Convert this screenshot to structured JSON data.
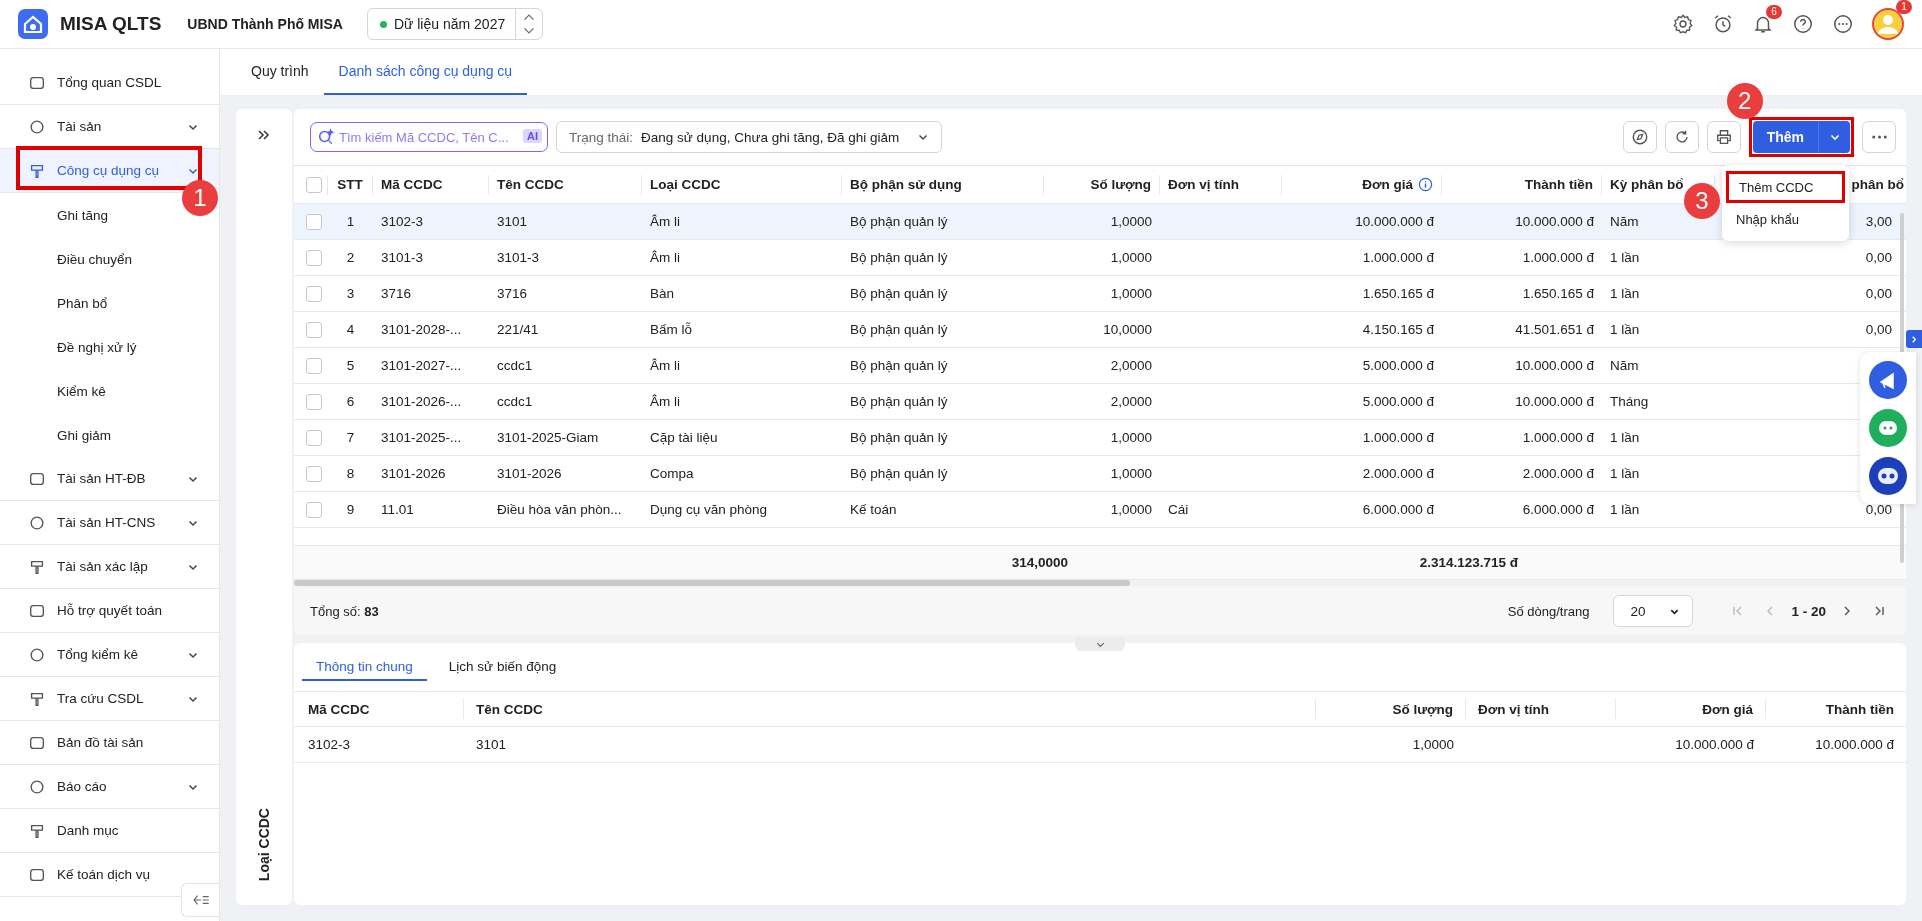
{
  "app": {
    "name": "MISA QLTS",
    "org": "UBND Thành Phố MISA",
    "year_selector": {
      "label": "Dữ liệu năm 2027"
    }
  },
  "header_badges": {
    "notifications": "6",
    "avatar": "1"
  },
  "sidebar": {
    "items": [
      {
        "label": "Tổng quan CSDL",
        "selected": false,
        "has_submenu": false
      },
      {
        "label": "Tài sản",
        "selected": false,
        "has_submenu": true
      },
      {
        "label": "Công cụ dụng cụ",
        "selected": true,
        "has_submenu": true,
        "children": [
          {
            "label": "Ghi tăng",
            "selected": false
          },
          {
            "label": "Điều chuyển",
            "selected": false
          },
          {
            "label": "Phân bổ",
            "selected": false
          },
          {
            "label": "Đề nghị xử lý",
            "selected": false
          },
          {
            "label": "Kiểm kê",
            "selected": false
          },
          {
            "label": "Ghi giảm",
            "selected": false
          }
        ]
      },
      {
        "label": "Tài sản HT-ĐB",
        "selected": false,
        "has_submenu": true
      },
      {
        "label": "Tài sản HT-CNS",
        "selected": false,
        "has_submenu": true
      },
      {
        "label": "Tài sản xác lập",
        "selected": false,
        "has_submenu": true
      },
      {
        "label": "Hỗ trợ quyết toán",
        "selected": false,
        "has_submenu": false
      },
      {
        "label": "Tổng kiểm kê",
        "selected": false,
        "has_submenu": true
      },
      {
        "label": "Tra cứu CSDL",
        "selected": false,
        "has_submenu": true
      },
      {
        "label": "Bản đồ tài sản",
        "selected": false,
        "has_submenu": false
      },
      {
        "label": "Báo cáo",
        "selected": false,
        "has_submenu": true
      },
      {
        "label": "Danh mục",
        "selected": false,
        "has_submenu": false
      },
      {
        "label": "Kế toán dịch vụ",
        "selected": false,
        "has_submenu": false
      }
    ]
  },
  "page_tabs": [
    {
      "label": "Quy trình",
      "selected": false
    },
    {
      "label": "Danh sách công cụ dụng cụ",
      "selected": true
    }
  ],
  "side_panel": {
    "label": "Loại CCDC"
  },
  "toolbar": {
    "search": {
      "placeholder": "Tìm kiếm Mã CCDC, Tên C...",
      "ai_badge": "AI"
    },
    "status_filter": {
      "label": "Trạng thái:",
      "value": "Đang sử dụng, Chưa ghi tăng, Đã ghi giảm"
    },
    "add_button": "Thêm"
  },
  "add_menu": {
    "items": [
      {
        "label": "Thêm CCDC",
        "highlighted": true
      },
      {
        "label": "Nhập khẩu",
        "highlighted": false
      }
    ]
  },
  "table": {
    "select_all_checked": false,
    "columns": [
      "STT",
      "Mã CCDC",
      "Tên CCDC",
      "Loại CCDC",
      "Bộ phận sử dụng",
      "Số lượng",
      "Đơn vị tính",
      "Đơn giá",
      "Thành tiền",
      "Kỳ phân bổ",
      "phân bổ"
    ],
    "rows": [
      {
        "selected": true,
        "checked": false,
        "cells": [
          "1",
          "3102-3",
          "3101",
          "Âm li",
          "Bộ phận quản lý",
          "1,0000",
          "",
          "10.000.000 đ",
          "10.000.000 đ",
          "Năm",
          "3,00"
        ]
      },
      {
        "selected": false,
        "checked": false,
        "cells": [
          "2",
          "3101-3",
          "3101-3",
          "Âm li",
          "Bộ phận quản lý",
          "1,0000",
          "",
          "1.000.000 đ",
          "1.000.000 đ",
          "1 lần",
          "0,00"
        ]
      },
      {
        "selected": false,
        "checked": false,
        "cells": [
          "3",
          "3716",
          "3716",
          "Bàn",
          "Bộ phận quản lý",
          "1,0000",
          "",
          "1.650.165 đ",
          "1.650.165 đ",
          "1 lần",
          "0,00"
        ]
      },
      {
        "selected": false,
        "checked": false,
        "cells": [
          "4",
          "3101-2028-...",
          "221/41",
          "Bấm lỗ",
          "Bộ phận quản lý",
          "10,0000",
          "",
          "4.150.165 đ",
          "41.501.651 đ",
          "1 lần",
          "0,00"
        ]
      },
      {
        "selected": false,
        "checked": false,
        "cells": [
          "5",
          "3101-2027-...",
          "ccdc1",
          "Âm li",
          "Bộ phận quản lý",
          "2,0000",
          "",
          "5.000.000 đ",
          "10.000.000 đ",
          "Năm"
        ]
      },
      {
        "selected": false,
        "checked": false,
        "cells": [
          "6",
          "3101-2026-...",
          "ccdc1",
          "Âm li",
          "Bộ phận quản lý",
          "2,0000",
          "",
          "5.000.000 đ",
          "10.000.000 đ",
          "Tháng"
        ]
      },
      {
        "selected": false,
        "checked": false,
        "cells": [
          "7",
          "3101-2025-...",
          "3101-2025-Giam",
          "Cặp tài liệu",
          "Bộ phận quản lý",
          "1,0000",
          "",
          "1.000.000 đ",
          "1.000.000 đ",
          "1 lần"
        ]
      },
      {
        "selected": false,
        "checked": false,
        "cells": [
          "8",
          "3101-2026",
          "3101-2026",
          "Compa",
          "Bộ phận quản lý",
          "1,0000",
          "",
          "2.000.000 đ",
          "2.000.000 đ",
          "1 lần"
        ]
      },
      {
        "selected": false,
        "checked": false,
        "cells": [
          "9",
          "11.01",
          "Điều hòa văn phòn...",
          "Dụng cụ văn phòng",
          "Kế toán",
          "1,0000",
          "Cái",
          "6.000.000 đ",
          "6.000.000 đ",
          "1 lần",
          "0,00"
        ]
      }
    ],
    "totals": {
      "quantity": "314,0000",
      "amount": "2.314.123.715 đ"
    }
  },
  "pagination": {
    "total_label": "Tổng số:",
    "total": "83",
    "rows_per_page_label": "Số dòng/trang",
    "rows_per_page": "20",
    "range": "1 - 20"
  },
  "detail": {
    "tabs": [
      {
        "label": "Thông tin chung",
        "selected": true
      },
      {
        "label": "Lịch sử biến động",
        "selected": false
      }
    ],
    "columns": [
      "Mã CCDC",
      "Tên CCDC",
      "Số lượng",
      "Đơn vị tính",
      "Đơn giá",
      "Thành tiền"
    ],
    "rows": [
      [
        "3102-3",
        "3101",
        "1,0000",
        "",
        "10.000.000 đ",
        "10.000.000 đ"
      ]
    ]
  },
  "annotations": [
    {
      "number": "1"
    },
    {
      "number": "2"
    },
    {
      "number": "3"
    }
  ]
}
